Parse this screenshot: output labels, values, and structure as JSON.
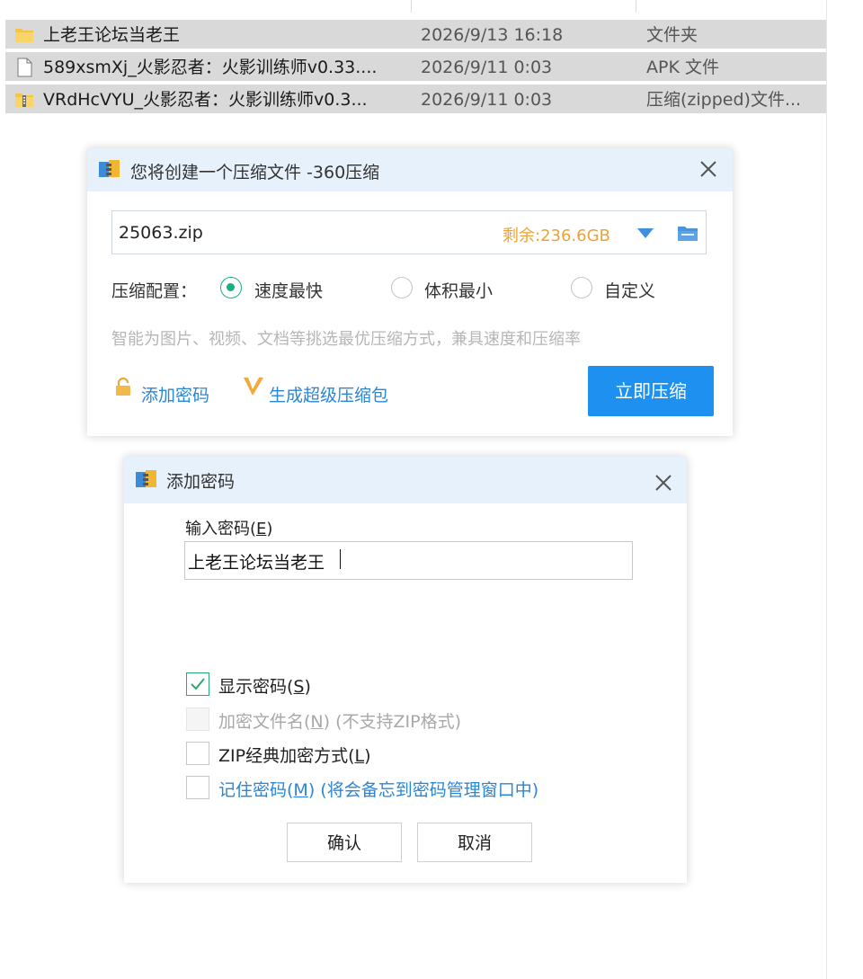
{
  "explorer": {
    "files": [
      {
        "name": "上老王论坛当老王",
        "date": "2026/9/13 16:18",
        "type": "文件夹",
        "icon": "folder-icon"
      },
      {
        "name": "589xsmXj_火影忍者：火影训练师v0.33....",
        "date": "2026/9/11 0:03",
        "type": "APK 文件",
        "icon": "file-icon"
      },
      {
        "name": "VRdHcVYU_火影忍者：火影训练师v0.3...",
        "date": "2026/9/11 0:03",
        "type": "压缩(zipped)文件...",
        "icon": "zip-folder-icon"
      }
    ]
  },
  "compress_dialog": {
    "title": "您将创建一个压缩文件 -360压缩",
    "filename": "25063.zip",
    "free_space": "剩余:236.6GB",
    "config_label": "压缩配置：",
    "options": [
      {
        "label": "速度最快",
        "selected": true
      },
      {
        "label": "体积最小",
        "selected": false
      },
      {
        "label": "自定义",
        "selected": false
      }
    ],
    "hint": "智能为图片、视频、文档等挑选最优压缩方式，兼具速度和压缩率",
    "add_password": "添加密码",
    "super_pack": "生成超级压缩包",
    "compress_now": "立即压缩",
    "colors": {
      "accent": "#1e90f0",
      "free_space": "#e8a33a",
      "radio": "#18b07b"
    }
  },
  "password_dialog": {
    "title": "添加密码",
    "input_label": "输入密码(",
    "input_label_key": "E",
    "input_label_end": ")",
    "password_value": "上老王论坛当老王",
    "options": [
      {
        "label": "显示密码(",
        "key": "S",
        "note": ")",
        "checked": true,
        "disabled": false
      },
      {
        "label": "加密文件名(",
        "key": "N",
        "note": ") (不支持ZIP格式)",
        "checked": false,
        "disabled": true
      },
      {
        "label": "ZIP经典加密方式(",
        "key": "L",
        "note": ")",
        "checked": false,
        "disabled": false
      },
      {
        "label": "记住密码(",
        "key": "M",
        "note": ") (将会备忘到密码管理窗口中)",
        "checked": false,
        "disabled": false
      }
    ],
    "confirm": "确认",
    "cancel": "取消"
  }
}
